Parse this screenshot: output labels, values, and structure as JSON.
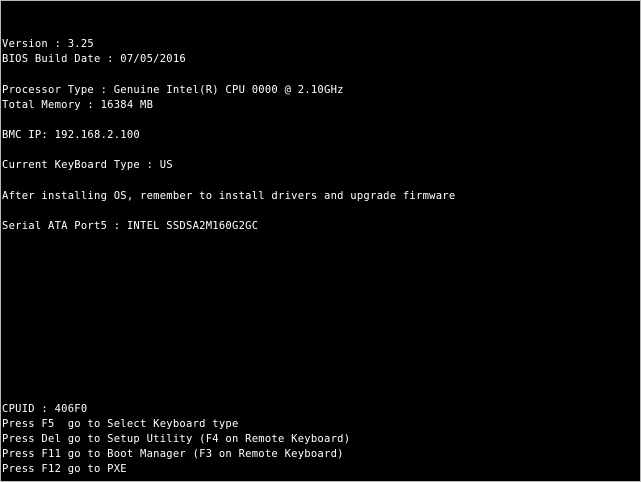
{
  "colors": {
    "background": "#000000",
    "text": "#ffffff"
  },
  "header": {
    "version": "Version : 3.25",
    "bios_build_date": "BIOS Build Date : 07/05/2016"
  },
  "system_info": {
    "processor_type": "Processor Type : Genuine Intel(R) CPU 0000 @ 2.10GHz",
    "total_memory": "Total Memory : 16384 MB",
    "bmc_ip": "BMC IP: 192.168.2.100",
    "keyboard_type": "Current KeyBoard Type : US",
    "notice": "After installing OS, remember to install drivers and upgrade firmware",
    "serial_ata": "Serial ATA Port5 : INTEL SSDSA2M160G2GC"
  },
  "footer": {
    "cpuid": "CPUID : 406F0",
    "hotkeys": [
      "Press F5  go to Select Keyboard type",
      "Press Del go to Setup Utility (F4 on Remote Keyboard)",
      "Press F11 go to Boot Manager (F3 on Remote Keyboard)",
      "Press F12 go to PXE"
    ]
  }
}
